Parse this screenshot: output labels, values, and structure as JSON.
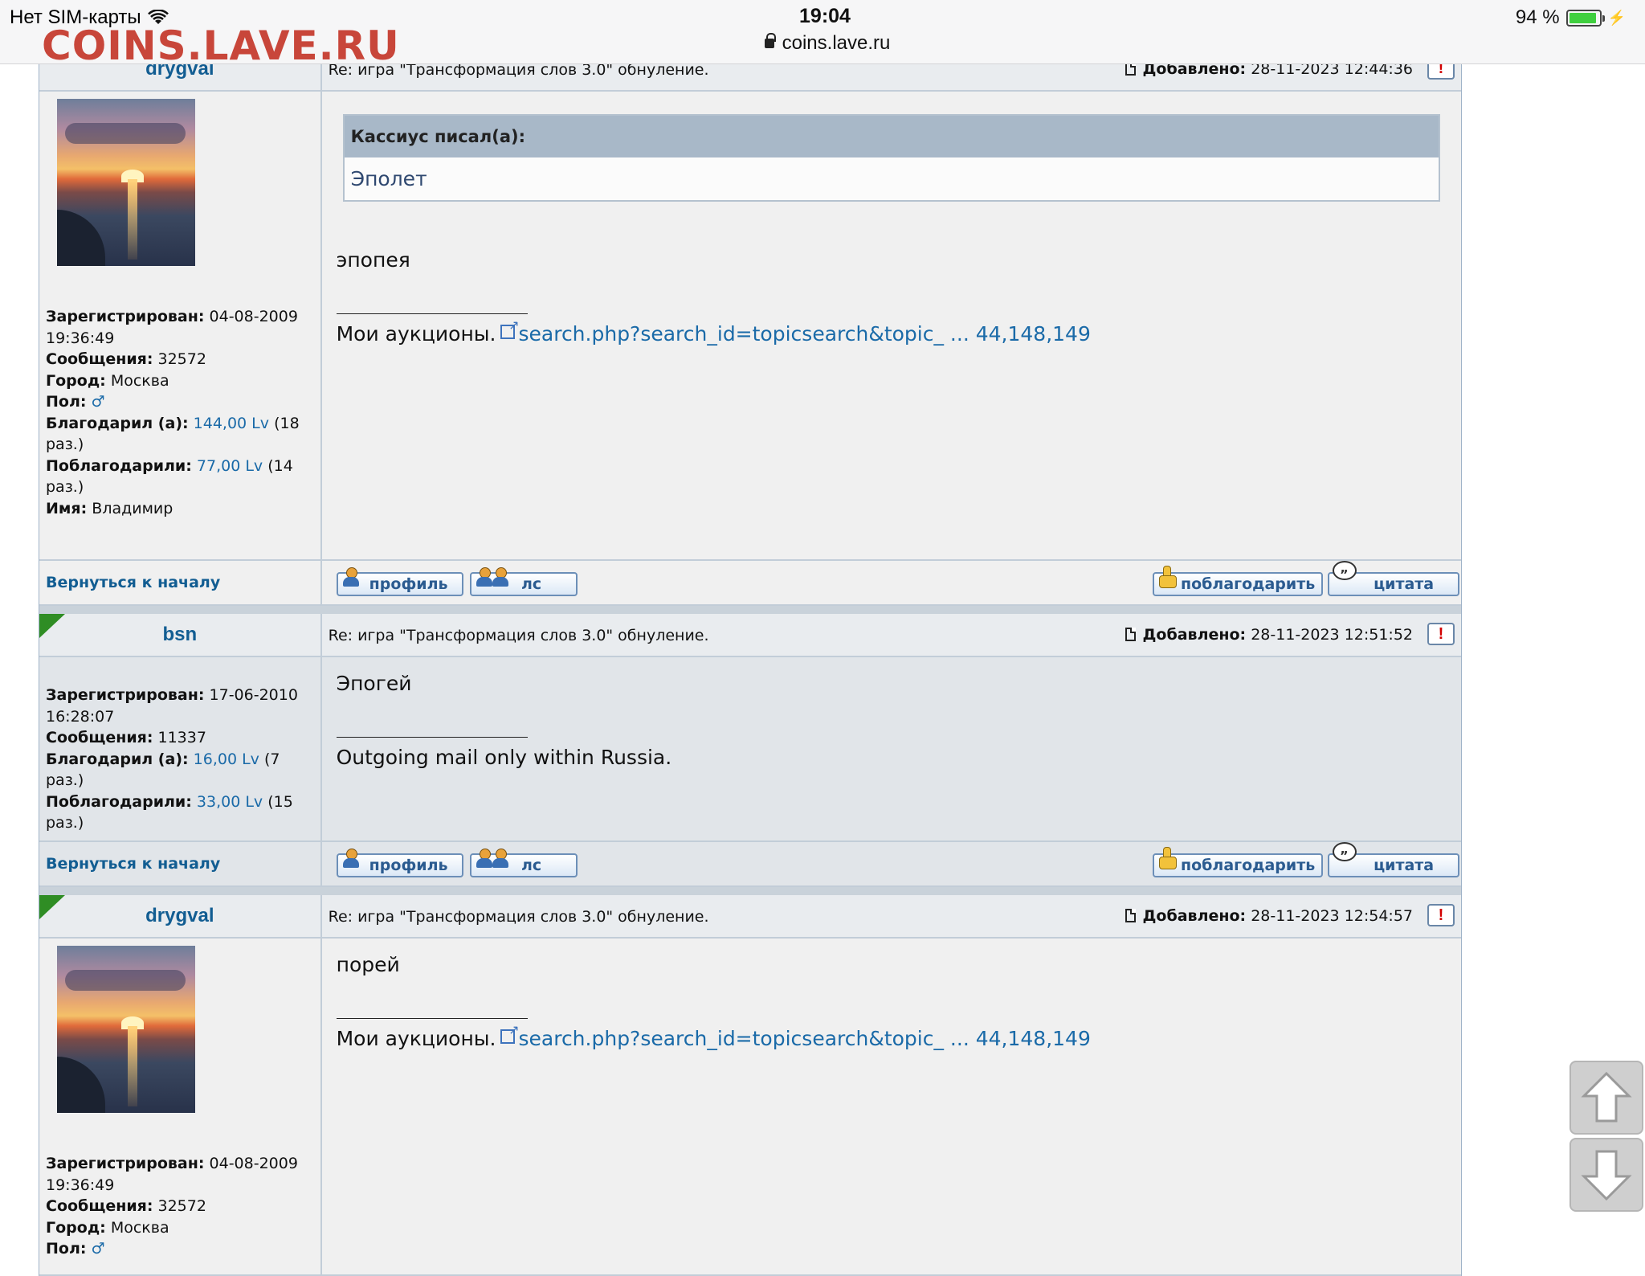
{
  "statusbar": {
    "carrier": "Нет SIM-карты",
    "time": "19:04",
    "url": "coins.lave.ru",
    "battery": "94 %",
    "battery_level": 0.94
  },
  "watermark": "COINS.LAVE.RU",
  "labels": {
    "added": "Добавлено:",
    "back": "Вернуться к началу",
    "profile_btn": "профиль",
    "pm_btn": "лс",
    "thanks_btn": "поблагодарить",
    "quote_btn": "цитата",
    "report": "!",
    "registered": "Зарегистрирован:",
    "messages": "Сообщения:",
    "city": "Город:",
    "gender": "Пол:",
    "thanked": "Благодарил (а):",
    "was_thanked": "Поблагодарили:",
    "name": "Имя:"
  },
  "posts": [
    {
      "author": "drygval",
      "subject": "Re: игра \"Трансформация слов 3.0\" обнуление.",
      "added_value": "28-11-2023 12:44:36",
      "profile": {
        "registered": "04-08-2009 19:36:49",
        "messages": "32572",
        "city": "Москва",
        "gender": "♂",
        "thanked_amount": "144,00 Lv",
        "thanked_times": "(18 раз.)",
        "was_thanked_amount": "77,00 Lv",
        "was_thanked_times": "(14 раз.)",
        "name": "Владимир"
      },
      "quote_author": "Кассиус писал(а):",
      "quote_text": "Эполет",
      "text": "эпопея",
      "signature_prefix": "Мои аукционы.",
      "signature_link": "search.php?search_id=topicsearch&topic_ ... 44,148,149"
    },
    {
      "author": "bsn",
      "subject": "Re: игра \"Трансформация слов 3.0\" обнуление.",
      "added_value": "28-11-2023 12:51:52",
      "profile": {
        "registered": "17-06-2010 16:28:07",
        "messages": "11337",
        "thanked_amount": "16,00 Lv",
        "thanked_times": "(7 раз.)",
        "was_thanked_amount": "33,00 Lv",
        "was_thanked_times": "(15 раз.)"
      },
      "text": "Эпогей",
      "signature": "Outgoing mail only within Russia."
    },
    {
      "author": "drygval",
      "subject": "Re: игра \"Трансформация слов 3.0\" обнуление.",
      "added_value": "28-11-2023 12:54:57",
      "profile": {
        "registered": "04-08-2009 19:36:49",
        "messages": "32572",
        "city": "Москва",
        "gender": "♂"
      },
      "text": "порей",
      "signature_prefix": "Мои аукционы.",
      "signature_link": "search.php?search_id=topicsearch&topic_ ... 44,148,149"
    }
  ]
}
